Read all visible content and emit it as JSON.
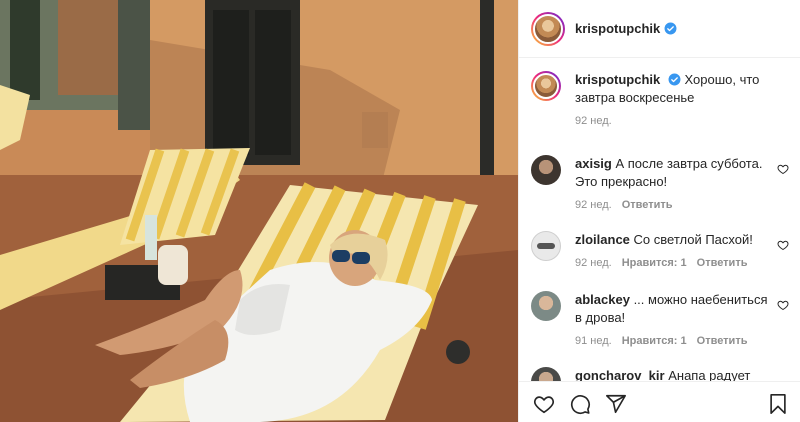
{
  "post": {
    "username": "krispotupchik",
    "verified_icon": "verified-badge-icon",
    "caption": "Хорошо, что завтра воскресенье",
    "caption_time": "92 нед."
  },
  "comments": [
    {
      "username": "axisig",
      "text": "А после завтра суббота. Это прекрасно!",
      "time": "92 нед.",
      "likes": "",
      "reply": "Ответить"
    },
    {
      "username": "zloilance",
      "text": "Со светлой Пасхой!",
      "time": "92 нед.",
      "likes": "Нравится: 1",
      "reply": "Ответить"
    },
    {
      "username": "ablackey",
      "text": "... можно наебениться в дрова!",
      "time": "91 нед.",
      "likes": "Нравится: 1",
      "reply": "Ответить"
    },
    {
      "username": "goncharov_kir",
      "text": "Анапа радует",
      "time": "",
      "likes": "",
      "reply": ""
    }
  ],
  "actions": {
    "like_icon": "heart-icon",
    "comment_icon": "comment-icon",
    "share_icon": "share-icon",
    "save_icon": "bookmark-icon"
  },
  "colors": {
    "verified": "#3897f0",
    "secondary_text": "#8e8e8e",
    "border": "#efefef"
  }
}
